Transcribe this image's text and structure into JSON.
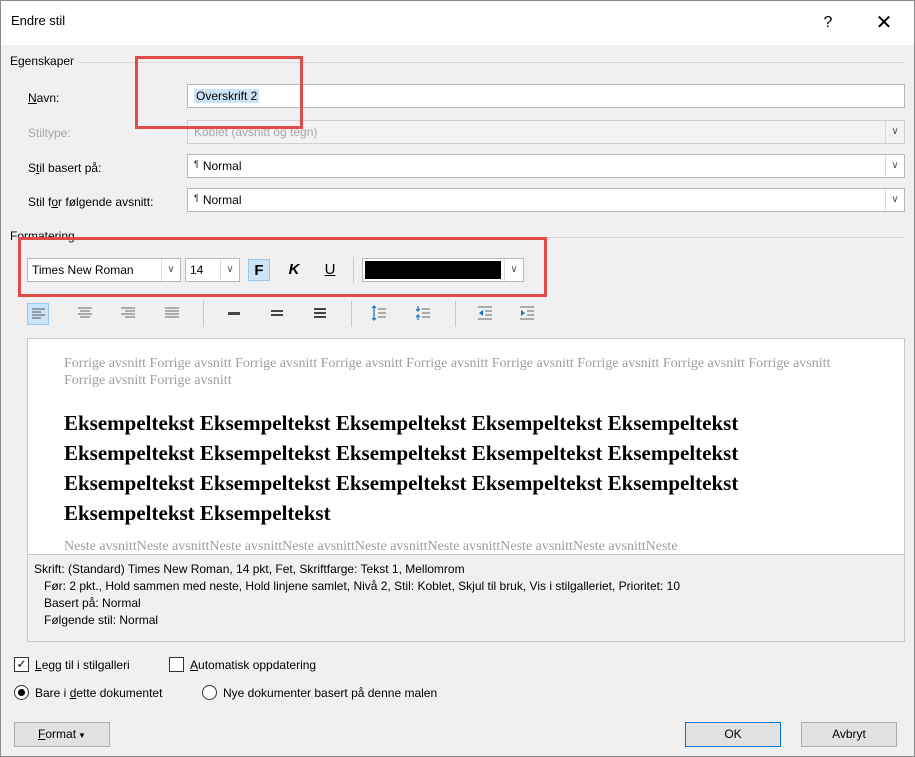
{
  "window": {
    "title": "Endre stil",
    "help_glyph": "?",
    "close_glyph": "✕"
  },
  "properties": {
    "group_label": "Egenskaper",
    "name_label": "Navn:",
    "name_value": "Overskrift 2",
    "style_type_label": "Stiltype:",
    "style_type_value": "Koblet (avsnitt og tegn)",
    "based_on_label": "Stil basert på:",
    "based_on_value": "Normal",
    "following_label": "Stil for følgende avsnitt:",
    "following_value": "Normal"
  },
  "formatting": {
    "group_label": "Formatering",
    "font_family": "Times New Roman",
    "font_size": "14",
    "bold_label": "F",
    "italic_label": "K",
    "underline_label": "U",
    "font_color": "#000000",
    "bold_active": true
  },
  "preview": {
    "previous_text": "Forrige avsnitt Forrige avsnitt Forrige avsnitt Forrige avsnitt Forrige avsnitt Forrige avsnitt Forrige avsnitt Forrige avsnitt Forrige avsnitt Forrige avsnitt Forrige avsnitt",
    "sample_text": "Eksempeltekst Eksempeltekst Eksempeltekst Eksempeltekst Eksempeltekst Eksempeltekst Eksempeltekst Eksempeltekst Eksempeltekst Eksempeltekst Eksempeltekst Eksempeltekst Eksempeltekst Eksempeltekst Eksempeltekst Eksempeltekst Eksempeltekst",
    "next_text": "Neste avsnittNeste avsnittNeste avsnittNeste avsnittNeste avsnittNeste avsnittNeste avsnittNeste avsnittNeste"
  },
  "description": {
    "line1": "Skrift: (Standard) Times New Roman, 14 pkt, Fet, Skriftfarge: Tekst 1, Mellomrom",
    "line2": "Før:  2 pkt., Hold sammen med neste, Hold linjene samlet, Nivå 2, Stil: Koblet, Skjul til bruk, Vis i stilgalleriet, Prioritet: 10",
    "line3": "Basert på: Normal",
    "line4": "Følgende stil: Normal"
  },
  "options": {
    "add_to_gallery_label": "Legg til i stilgalleri",
    "add_to_gallery_checked": true,
    "auto_update_label": "Automatisk oppdatering",
    "auto_update_checked": false,
    "only_this_doc_label": "Bare i dette dokumentet",
    "new_docs_label": "Nye dokumenter basert på denne malen",
    "selected_scope": "only_this_doc"
  },
  "buttons": {
    "format_label": "Format",
    "ok_label": "OK",
    "cancel_label": "Avbryt"
  }
}
